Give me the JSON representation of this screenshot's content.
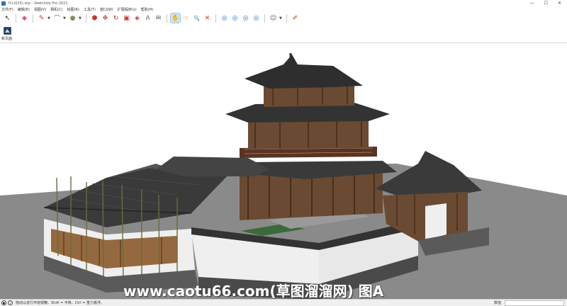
{
  "window": {
    "title": "fl+(025).skp - SketchUp Pro 2021",
    "controls": [
      "—",
      "☐",
      "✕"
    ]
  },
  "menu": [
    "文件(F)",
    "编辑(E)",
    "视图(V)",
    "相机(C)",
    "绘图(R)",
    "工具(T)",
    "窗口(W)",
    "扩展程序(x)",
    "帮助(H)"
  ],
  "toolbar": {
    "tools": [
      {
        "name": "select",
        "glyph": "↖"
      },
      {
        "name": "eraser",
        "glyph": "◆"
      },
      {
        "name": "pencil",
        "glyph": "✎"
      },
      {
        "name": "arc",
        "glyph": "⌒"
      },
      {
        "name": "shape",
        "glyph": "●"
      },
      {
        "name": "push-pull",
        "glyph": "⬢"
      },
      {
        "name": "move",
        "glyph": "✥"
      },
      {
        "name": "rotate",
        "glyph": "↻"
      },
      {
        "name": "scale",
        "glyph": "▣"
      },
      {
        "name": "offset",
        "glyph": "◈"
      },
      {
        "name": "tape",
        "glyph": "A"
      },
      {
        "name": "text",
        "glyph": "✉"
      },
      {
        "name": "orbit",
        "glyph": "✋"
      },
      {
        "name": "pan",
        "glyph": "☞"
      },
      {
        "name": "zoom",
        "glyph": "🔍"
      },
      {
        "name": "zoom-extents",
        "glyph": "✕"
      },
      {
        "name": "warehouse",
        "glyph": "◎"
      },
      {
        "name": "extension-warehouse",
        "glyph": "◎"
      },
      {
        "name": "layout",
        "glyph": "◎"
      },
      {
        "name": "style",
        "glyph": "◎"
      },
      {
        "name": "account",
        "glyph": "☺"
      },
      {
        "name": "report",
        "glyph": "✐"
      }
    ]
  },
  "scenes": {
    "label": "新页面"
  },
  "status": {
    "hint": "拖动以进行环绕观察。Shift = 平移。Ctrl = 重力悬浮。",
    "measurements_label": "数值",
    "measurements_value": ""
  },
  "watermark": "www.caotu66.com(草图溜溜网) 图A",
  "colors": {
    "sky": "#ffffff",
    "ground": "#8a8a8a",
    "roof": "#3a3a3a",
    "timber": "#5a3322",
    "wall": "#efefef"
  }
}
